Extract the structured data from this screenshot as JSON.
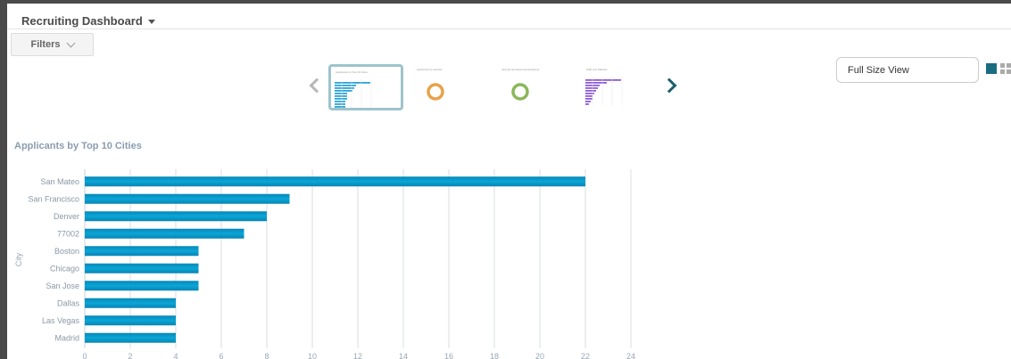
{
  "header": {
    "title": "Recruiting Dashboard"
  },
  "filters": {
    "label": "Filters"
  },
  "carousel": {
    "thumbnails": [
      {
        "title": "Applicants by Top 10 Cities",
        "kind": "bar",
        "color": "#2aa3d3",
        "active": true
      },
      {
        "title": "Applicants by Gender",
        "kind": "donut",
        "color": "#e8a24a",
        "active": false
      },
      {
        "title": "Internal and External Applicants",
        "kind": "donut",
        "color": "#8bb85a",
        "active": false
      },
      {
        "title": "Staff and Salaries",
        "kind": "bar",
        "color": "#8e5bd4",
        "active": false
      }
    ]
  },
  "view": {
    "full_size_label": "Full Size View",
    "single_icon": "single-view-icon",
    "grid_icon": "grid-view-icon",
    "accent": "#1a6d80"
  },
  "chart_title": "Applicants by Top 10 Cities",
  "chart_data": {
    "type": "bar",
    "orientation": "horizontal",
    "title": "Applicants by Top 10 Cities",
    "ylabel": "City",
    "xlabel": "",
    "categories": [
      "San Mateo",
      "San Francisco",
      "Denver",
      "77002",
      "Boston",
      "Chicago",
      "San Jose",
      "Dallas",
      "Las Vegas",
      "Madrid"
    ],
    "values": [
      22,
      9,
      8,
      7,
      5,
      5,
      5,
      4,
      4,
      4
    ],
    "xlim": [
      0,
      24
    ],
    "xticks": [
      0,
      2,
      4,
      6,
      8,
      10,
      12,
      14,
      16,
      18,
      20,
      22,
      24
    ],
    "grid": true,
    "bar_color": "#0a9cc9"
  }
}
